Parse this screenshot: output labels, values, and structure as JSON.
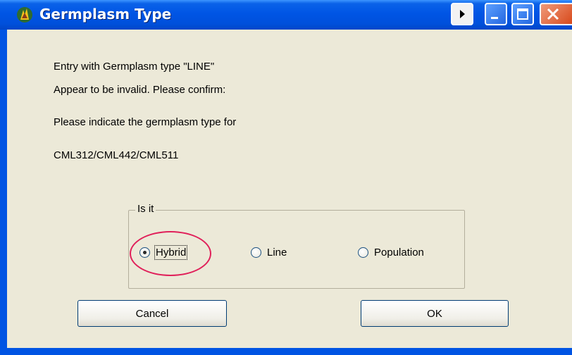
{
  "window": {
    "title": "Germplasm Type",
    "controls": {
      "play_icon": "play-arrow-icon",
      "minimize_icon": "minimize-icon",
      "maximize_icon": "maximize-icon",
      "close_icon": "close-icon"
    }
  },
  "message": {
    "line1": "Entry with Germplasm type \"LINE\"",
    "line2": "Appear to be invalid. Please confirm:",
    "line3": "Please indicate the germplasm type for",
    "line4": "CML312/CML442/CML511"
  },
  "group": {
    "legend": "Is it",
    "options": [
      {
        "label": "Hybrid",
        "selected": true
      },
      {
        "label": "Line",
        "selected": false
      },
      {
        "label": "Population",
        "selected": false
      }
    ]
  },
  "buttons": {
    "cancel": "Cancel",
    "ok": "OK"
  },
  "colors": {
    "titlebar": "#0054e3",
    "client_bg": "#ece9d8",
    "highlight": "#e0205a"
  }
}
